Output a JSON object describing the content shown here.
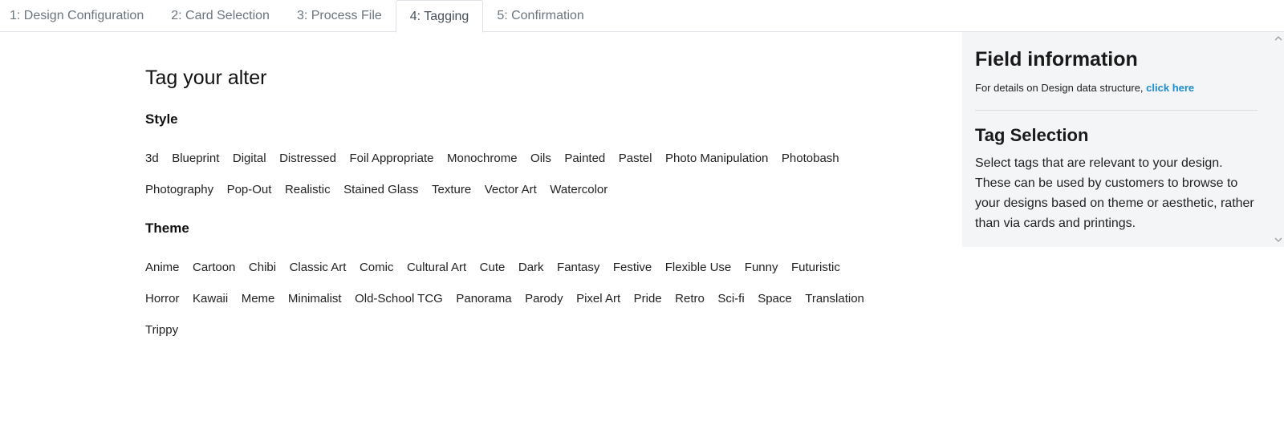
{
  "tabs": [
    {
      "label": "1: Design Configuration"
    },
    {
      "label": "2: Card Selection"
    },
    {
      "label": "3: Process File"
    },
    {
      "label": "4: Tagging",
      "active": true
    },
    {
      "label": "5: Confirmation"
    }
  ],
  "main": {
    "title": "Tag your alter",
    "style": {
      "heading": "Style",
      "rows": [
        [
          "3d",
          "Blueprint",
          "Digital",
          "Distressed",
          "Foil Appropriate",
          "Monochrome",
          "Oils",
          "Painted",
          "Pastel",
          "Photo Manipulation",
          "Photobash"
        ],
        [
          "Photography",
          "Pop-Out",
          "Realistic",
          "Stained Glass",
          "Texture",
          "Vector Art",
          "Watercolor"
        ]
      ]
    },
    "theme": {
      "heading": "Theme",
      "rows": [
        [
          "Anime",
          "Cartoon",
          "Chibi",
          "Classic Art",
          "Comic",
          "Cultural Art",
          "Cute",
          "Dark",
          "Fantasy",
          "Festive",
          "Flexible Use",
          "Funny",
          "Futuristic"
        ],
        [
          "Horror",
          "Kawaii",
          "Meme",
          "Minimalist",
          "Old-School TCG",
          "Panorama",
          "Parody",
          "Pixel Art",
          "Pride",
          "Retro",
          "Sci-fi",
          "Space",
          "Translation"
        ],
        [
          "Trippy"
        ]
      ]
    }
  },
  "side": {
    "field_info_title": "Field information",
    "details_text": "For details on Design data structure, ",
    "details_link": "click here",
    "tag_selection_title": "Tag Selection",
    "tag_selection_text": "Select tags that are relevant to your design. These can be used by customers to browse to your designs based on theme or aesthetic, rather than via cards and printings.",
    "scroll_up_icon": "chevron-up-icon",
    "scroll_down_icon": "chevron-down-icon"
  },
  "colors": {
    "link": "#1a8ccf",
    "side_bg": "#f4f5f7",
    "tab_border": "#dee2e6"
  }
}
